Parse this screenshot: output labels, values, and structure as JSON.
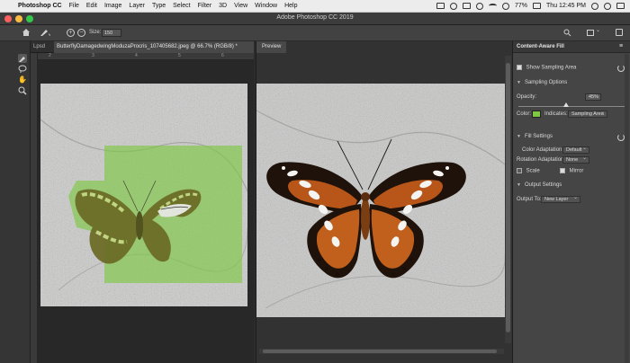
{
  "menubar": {
    "app_name": "Photoshop CC",
    "items": [
      "File",
      "Edit",
      "Image",
      "Layer",
      "Type",
      "Select",
      "Filter",
      "3D",
      "View",
      "Window",
      "Help"
    ],
    "battery": "77%",
    "clock": "Thu 12:45 PM"
  },
  "window": {
    "title": "Adobe Photoshop CC 2019",
    "traffic_colors": [
      "#fc605c",
      "#fdbc40",
      "#34c84a"
    ]
  },
  "options_bar": {
    "size_label": "Size:",
    "size_value": "150",
    "minus": "−",
    "plus": "+"
  },
  "document_tabs": [
    {
      "label": "Lpsd",
      "active": false
    },
    {
      "label": "ButterflyDamagedwingModuzaProcris_107405682.jpeg @ 66.7% (RGB/8) *",
      "active": true
    }
  ],
  "rulers": {
    "top_marks": [
      "2",
      "3",
      "4",
      "5",
      "6"
    ]
  },
  "preview": {
    "tab_label": "Preview"
  },
  "panel": {
    "title": "Content-Aware Fill",
    "show_sampling_area": {
      "label": "Show Sampling Area",
      "checked": true
    },
    "sampling_options": {
      "header": "Sampling Options",
      "opacity_label": "Opacity:",
      "opacity_value": "45%",
      "opacity_level": 0.45,
      "color_label": "Color:",
      "color_value": "#7ec843",
      "indicates_label": "Indicates:",
      "indicates_value": "Sampling Area"
    },
    "fill_settings": {
      "header": "Fill Settings",
      "color_adaptation_label": "Color Adaptation:",
      "color_adaptation_value": "Default",
      "rotation_adaptation_label": "Rotation Adaptation:",
      "rotation_adaptation_value": "None",
      "scale_label": "Scale",
      "scale_checked": false,
      "mirror_label": "Mirror",
      "mirror_checked": true
    },
    "output_settings": {
      "header": "Output Settings",
      "output_to_label": "Output To:",
      "output_to_value": "New Layer"
    }
  }
}
